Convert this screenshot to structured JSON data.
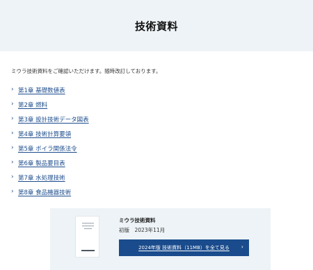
{
  "hero": {
    "title": "技術資料"
  },
  "intro": "ミウラ技術資料をご確認いただけます。随時改訂しております。",
  "chapters": [
    "第1章 基礎数値表",
    "第2章 燃料",
    "第3章 設計技術データ図表",
    "第4章 技術計算要領",
    "第5章 ボイラ関係法令",
    "第6章 製品要目表",
    "第7章 水処理技術",
    "第8章 食品機器技術"
  ],
  "icons": {
    "chapter": "chevron-right-icon",
    "button": "chevron-right-icon"
  },
  "card": {
    "title": "ミウラ技術資料",
    "edition": "初版　2023年11月",
    "button_label": "2024年版 技術資料（11MB）を全て見る"
  },
  "colors": {
    "link": "#1a4b8c",
    "button": "#1a4b8c",
    "hero_bg": "#edf3f6",
    "card_bg": "#edf3f6"
  }
}
